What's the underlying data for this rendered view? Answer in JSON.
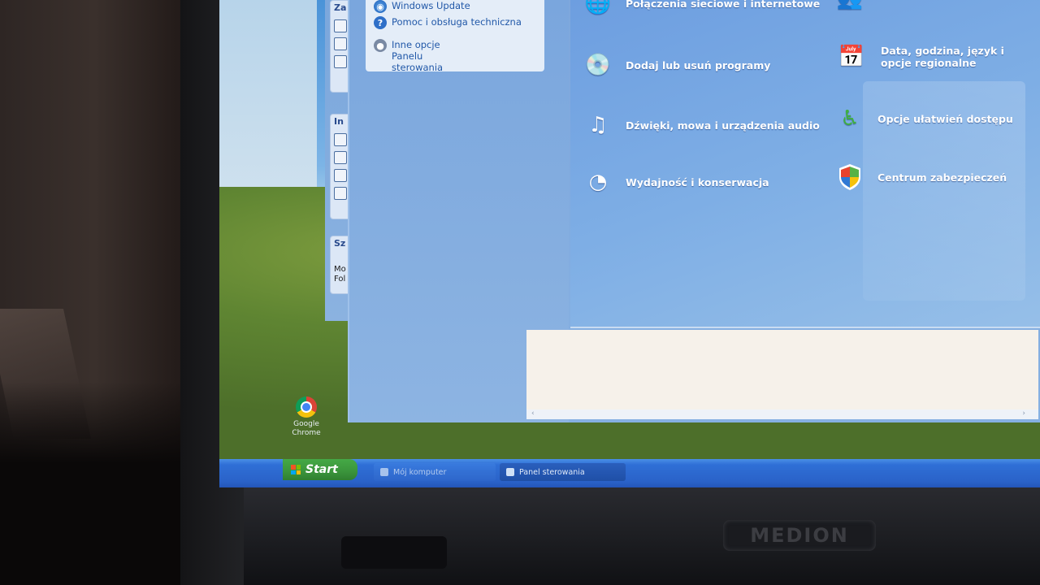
{
  "sidebar": {
    "links": [
      {
        "icon": "windows-update-icon",
        "label": "Windows Update"
      },
      {
        "icon": "help-icon",
        "label": "Pomoc i obsługa techniczna"
      },
      {
        "icon": "other-options-icon",
        "label": "Inne opcje Panelu sterowania"
      }
    ]
  },
  "behind_window": {
    "card1_title": "Za",
    "card2_title": "In",
    "card3_title": "Sz",
    "card3_line1": "Mo",
    "card3_line2": "Fol"
  },
  "categories": [
    {
      "id": "network",
      "label": "Połączenia sieciowe i internetowe",
      "icon": "network-icon"
    },
    {
      "id": "add-remove",
      "label": "Dodaj lub usuń programy",
      "icon": "add-remove-programs-icon"
    },
    {
      "id": "sounds",
      "label": "Dźwięki, mowa i urządzenia audio",
      "icon": "sound-icon"
    },
    {
      "id": "performance",
      "label": "Wydajność i konserwacja",
      "icon": "performance-icon"
    },
    {
      "id": "user-accounts",
      "label": "",
      "icon": "user-accounts-icon"
    },
    {
      "id": "datetime",
      "label": "Data, godzina, język i opcje regionalne",
      "icon": "date-time-icon"
    },
    {
      "id": "accessibility",
      "label": "Opcje ułatwień dostępu",
      "icon": "accessibility-icon"
    },
    {
      "id": "security",
      "label": "Centrum zabezpieczeń",
      "icon": "security-shield-icon"
    }
  ],
  "scrollbar": {
    "left_arrow": "‹",
    "right_arrow": "›"
  },
  "desktop": {
    "icons": [
      {
        "label": "Google\nChrome",
        "icon": "chrome-icon"
      }
    ]
  },
  "taskbar": {
    "start_label": "Start",
    "buttons": [
      {
        "label": "Mój komputer"
      },
      {
        "label": "Panel sterowania"
      }
    ]
  },
  "hardware": {
    "brand": "MEDION"
  }
}
